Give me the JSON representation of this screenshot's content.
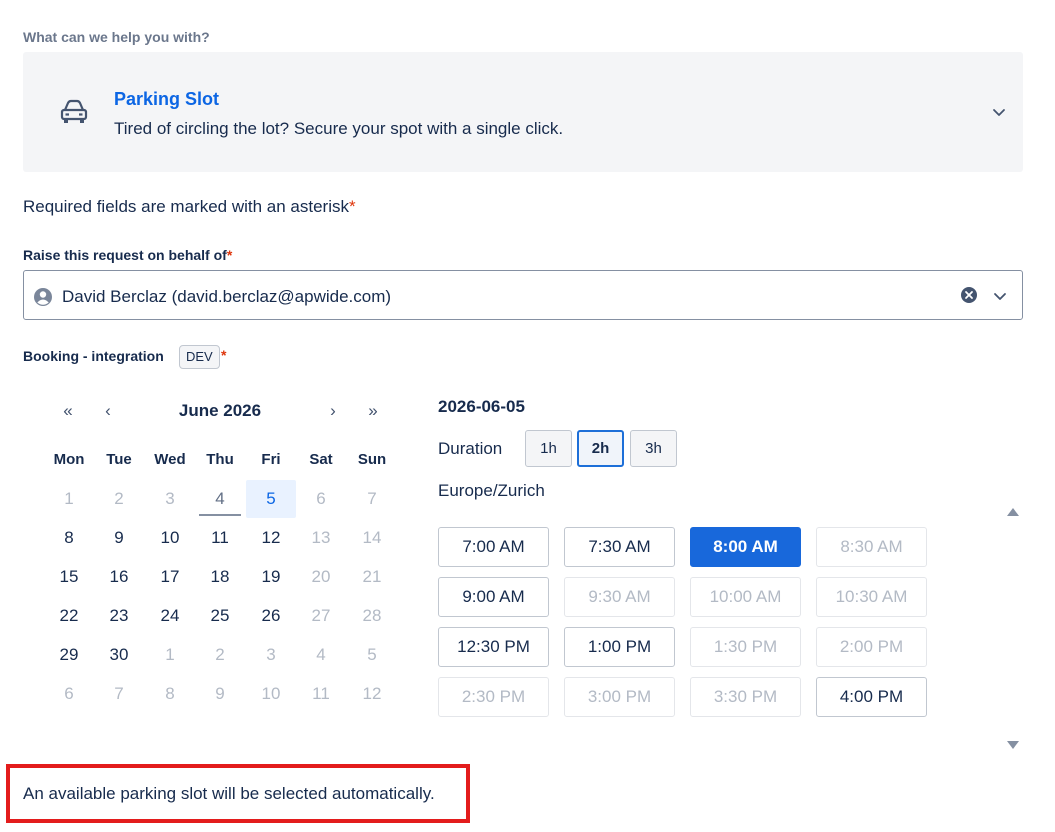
{
  "help_label": "What can we help you with?",
  "request_type": {
    "icon": "car-icon",
    "title": "Parking Slot",
    "description": "Tired of circling the lot? Secure your spot with a single click."
  },
  "required_note": "Required fields are marked with an asterisk",
  "required_star": "*",
  "behalf": {
    "label": "Raise this request on behalf of",
    "star": "*",
    "value": "David Berclaz (david.berclaz@apwide.com)"
  },
  "booking": {
    "label": "Booking - integration",
    "badge": "DEV",
    "star": "*"
  },
  "calendar": {
    "month_label": "June 2026",
    "nav": {
      "prev_year": "«",
      "prev_month": "‹",
      "next_month": "›",
      "next_year": "»"
    },
    "weekdays": [
      "Mon",
      "Tue",
      "Wed",
      "Thu",
      "Fri",
      "Sat",
      "Sun"
    ],
    "weeks": [
      [
        "1",
        "2",
        "3",
        "4",
        "5",
        "6",
        "7"
      ],
      [
        "8",
        "9",
        "10",
        "11",
        "12",
        "13",
        "14"
      ],
      [
        "15",
        "16",
        "17",
        "18",
        "19",
        "20",
        "21"
      ],
      [
        "22",
        "23",
        "24",
        "25",
        "26",
        "27",
        "28"
      ],
      [
        "29",
        "30",
        "1",
        "2",
        "3",
        "4",
        "5"
      ],
      [
        "6",
        "7",
        "8",
        "9",
        "10",
        "11",
        "12"
      ]
    ],
    "today_day": "4",
    "selected_day": "5"
  },
  "selected_date": "2026-06-05",
  "duration": {
    "label": "Duration",
    "options": [
      "1h",
      "2h",
      "3h"
    ],
    "selected": "2h"
  },
  "timezone": "Europe/Zurich",
  "time_slots": [
    [
      "7:00 AM",
      "7:30 AM",
      "8:00 AM",
      "8:30 AM"
    ],
    [
      "9:00 AM",
      "9:30 AM",
      "10:00 AM",
      "10:30 AM"
    ],
    [
      "12:30 PM",
      "1:00 PM",
      "1:30 PM",
      "2:00 PM"
    ],
    [
      "2:30 PM",
      "3:00 PM",
      "3:30 PM",
      "4:00 PM"
    ]
  ],
  "selected_slot": "8:00 AM",
  "auto_note": "An available parking slot will be selected automatically.",
  "colors": {
    "accent": "#1868db",
    "link": "#0c66e4",
    "required": "#de350b",
    "highlight_border": "#e31c1c"
  }
}
